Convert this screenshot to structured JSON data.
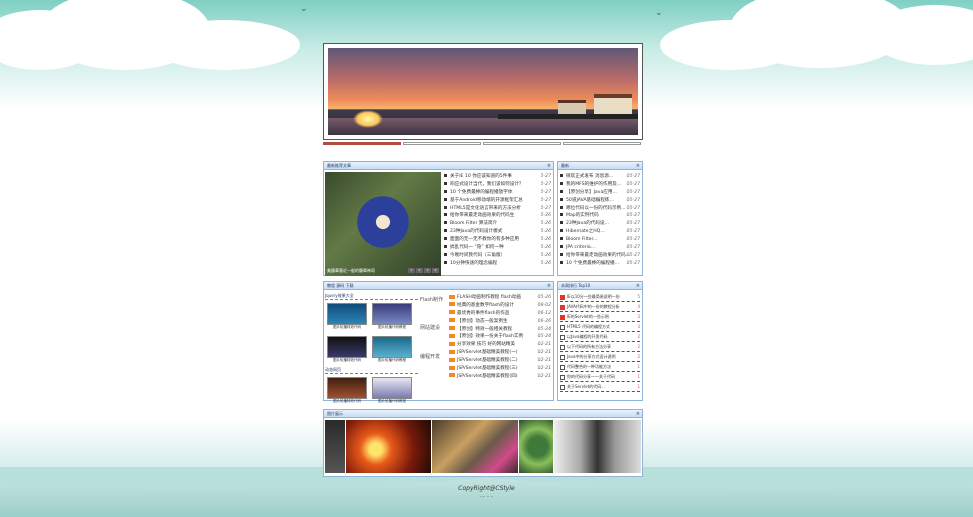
{
  "banner": {
    "slide_count": 4,
    "active_slide": 1
  },
  "news_panel": {
    "title": "最新推荐文章",
    "caption": "美國華裔近一般的簡單神奇",
    "pager": [
      "1",
      "2",
      "3",
      "4"
    ],
    "items": [
      {
        "title": "关于IE 10 你应该知道的5件事",
        "date": "5-27"
      },
      {
        "title": "响应式设计当代，我们该如何设计？",
        "date": "5-27"
      },
      {
        "title": "10 个免费最棒的编程播放字体",
        "date": "5-27"
      },
      {
        "title": "基于Android移动端的开源框架汇总",
        "date": "5-27"
      },
      {
        "title": "HTML5是文化语言带来的方法分析",
        "date": "5-27"
      },
      {
        "title": "给你带来最走动画效果的代码生",
        "date": "5-26"
      },
      {
        "title": "Bloom Filter 算法简介",
        "date": "5-26"
      },
      {
        "title": "23种Java的代码设计模式",
        "date": "5-26"
      },
      {
        "title": "面面的无一无不教你的有多种应用",
        "date": "5-26"
      },
      {
        "title": "搞乱代码一 “隐” 如何一种",
        "date": "5-26"
      },
      {
        "title": "今晚时间我代码（三角版）",
        "date": "5-26"
      },
      {
        "title": "10分钟快速的理念编程",
        "date": "5-26"
      }
    ]
  },
  "latest_panel": {
    "title": "最新",
    "items": [
      {
        "title": "微软正式发布 消息源...",
        "date": "05-27"
      },
      {
        "title": "我的MFS的维护的作用及...",
        "date": "05-27"
      },
      {
        "title": "【原创分享】Java应用...",
        "date": "05-27"
      },
      {
        "title": "50道JAVA基础编程练...",
        "date": "05-27"
      },
      {
        "title": "哪位代码以一份的代码示例...",
        "date": "05-27"
      },
      {
        "title": "Map的实例代码",
        "date": "05-27"
      },
      {
        "title": "23种Java的代码设...",
        "date": "05-27"
      },
      {
        "title": "Hibernate之HQ...",
        "date": "05-27"
      },
      {
        "title": "Bloom Filter...",
        "date": "05-27"
      },
      {
        "title": "JPA criteria...",
        "date": "05-27"
      },
      {
        "title": "给你带来最走动画效果的代码...",
        "date": "05-27"
      },
      {
        "title": "10 个免费最棒的编程播...",
        "date": "05-27"
      }
    ]
  },
  "tutorial_panel": {
    "title": "教程 源码 下载",
    "grid_title": "Jquery效果大全",
    "grid2_title": "动态网页",
    "thumbs": [
      "图片轮播特效代码",
      "图片轮播代码教程",
      "图片轮播特效代码",
      "图片轮播代码教程",
      "图片轮播特效代码",
      "图片轮播代码教程"
    ],
    "categories": [
      "Flash制作",
      "网站建设",
      "编程开发"
    ],
    "items": [
      {
        "title": "FLASH动画制作教程 flash动画",
        "date": "05-26"
      },
      {
        "title": "经典的基金数字flash的设计",
        "date": "08-02"
      },
      {
        "title": "最优秀的事件flash的作品",
        "date": "06-12"
      },
      {
        "title": "【原创】动态一般案例生",
        "date": "06-26"
      },
      {
        "title": "【原创】特效一般相关教程",
        "date": "05-24"
      },
      {
        "title": "【原创】效果一份关于flash实例",
        "date": "05-24"
      },
      {
        "title": "分享效果 技巧 好的网站精美",
        "date": "02-21"
      },
      {
        "title": "JSP/Servlet基础精美教程(一)",
        "date": "02-21"
      },
      {
        "title": "JSP/Servlet基础精美教程(二)",
        "date": "02-21"
      },
      {
        "title": "JSP/Servlet基础精美教程(三)",
        "date": "02-21"
      },
      {
        "title": "JSP/Servlet基础精美教程(四)",
        "date": "02-21"
      }
    ]
  },
  "rank_panel": {
    "title": "本周排行 Top10",
    "items": [
      {
        "title": "IE以10分一些最简易说明一份",
        "tag": "5"
      },
      {
        "title": "JAVA代码中的一份的教程分析",
        "tag": "4"
      },
      {
        "title": "IE的Servlet的一些示例",
        "tag": "3"
      },
      {
        "title": "HTML5 代码的编程方式",
        "tag": "3"
      },
      {
        "title": "以Java编程的开发代码",
        "tag": "2"
      },
      {
        "title": "以下代码的所有方法分享",
        "tag": "2"
      },
      {
        "title": "Java中的分享方式设计说明",
        "tag": "2"
      },
      {
        "title": "代码整合的一种功能方法",
        "tag": "1"
      },
      {
        "title": "你的代码分享一一关于代码",
        "tag": "1"
      },
      {
        "title": "关于Servlet的代码...",
        "tag": "1"
      }
    ]
  },
  "photo_panel": {
    "title": "图片展示"
  },
  "footer": {
    "copyright": "CopyRight@CStyle",
    "sub": "···· ·· ··"
  }
}
